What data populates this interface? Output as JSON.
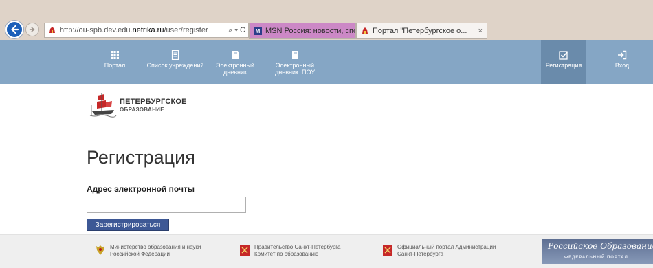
{
  "browser": {
    "address_prefix": "http://ou-spb.dev.edu.",
    "address_host": "netrika.ru",
    "address_suffix": "/user/register",
    "address_tools": "⌕ ▾ C",
    "tabs": [
      {
        "label": "MSN Россия: новости, спорт, ..."
      },
      {
        "label": "Портал \"Петербургское о...",
        "close": "×"
      }
    ]
  },
  "navbar": {
    "items": [
      {
        "label": "Портал"
      },
      {
        "label": "Список учреждений"
      },
      {
        "label_1": "Электронный",
        "label_2": "дневник"
      },
      {
        "label_1": "Электронный",
        "label_2": "дневник. ПОУ"
      }
    ],
    "register_label": "Регистрация",
    "login_label": "Вход"
  },
  "logo": {
    "line1": "ПЕТЕРБУРГСКОЕ",
    "line2": "ОБРАЗОВАНИЕ"
  },
  "form": {
    "title": "Регистрация",
    "email_label": "Адрес электронной почты",
    "email_value": "",
    "submit_label": "Зарегистрироваться"
  },
  "footer": {
    "ministry_1": "Министерство образования и науки",
    "ministry_2": "Российской Федерации",
    "gov_1": "Правительство Санкт-Петербурга",
    "gov_2": "Комитет по образованию",
    "admin_1": "Официальный портал Администрации",
    "admin_2": "Санкт-Петербурга",
    "banner_title": "Российское Образование",
    "banner_sub": "ФЕДЕРАЛЬНЫЙ ПОРТАЛ"
  },
  "colors": {
    "navbar": "#85a6c5",
    "navbar_active": "#6a8bab",
    "button": "#3d5895",
    "msn_tab": "#cc88c6"
  }
}
